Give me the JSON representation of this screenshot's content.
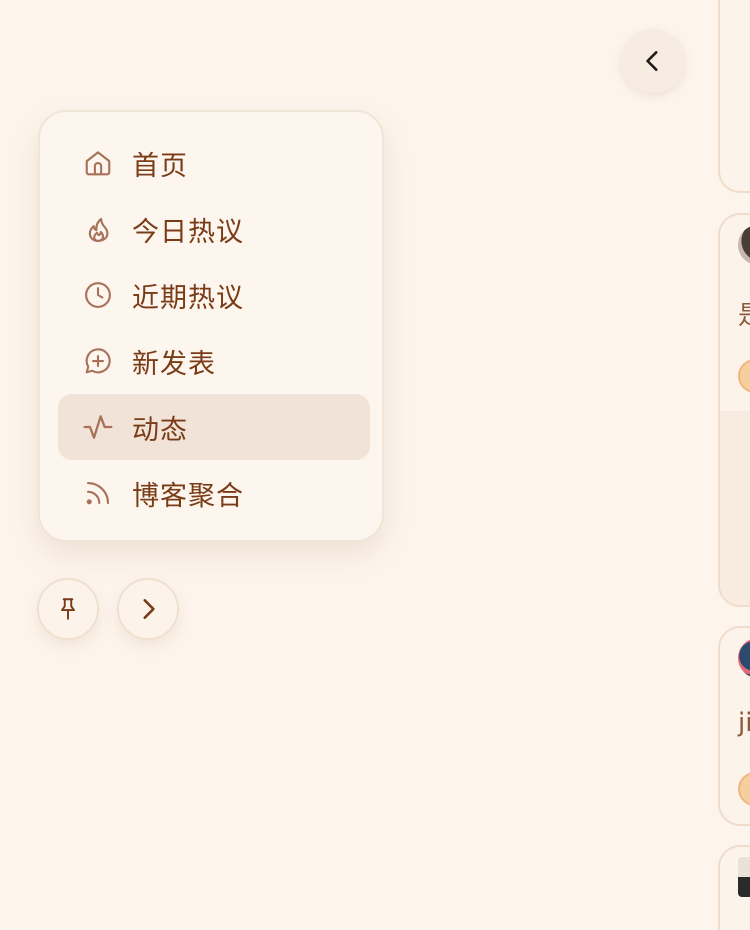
{
  "colors": {
    "background": "#fdf5ec",
    "accent_text": "#7a3c17",
    "icon_color": "#a8725a",
    "active_bg": "#f1e3d8"
  },
  "header": {
    "back_icon": "chevron-left-icon"
  },
  "menu": {
    "items": [
      {
        "label": "首页",
        "icon": "home-icon",
        "active": false
      },
      {
        "label": "今日热议",
        "icon": "flame-icon",
        "active": false
      },
      {
        "label": "近期热议",
        "icon": "clock-icon",
        "active": false
      },
      {
        "label": "新发表",
        "icon": "message-plus-icon",
        "active": false
      },
      {
        "label": "动态",
        "icon": "activity-icon",
        "active": true
      },
      {
        "label": "博客聚合",
        "icon": "rss-icon",
        "active": false
      }
    ]
  },
  "footer_buttons": {
    "pin_icon": "pin-icon",
    "expand_icon": "chevron-right-icon"
  },
  "feed_cards": [
    {
      "snippet": "是"
    },
    {
      "snippet": "ji"
    }
  ]
}
